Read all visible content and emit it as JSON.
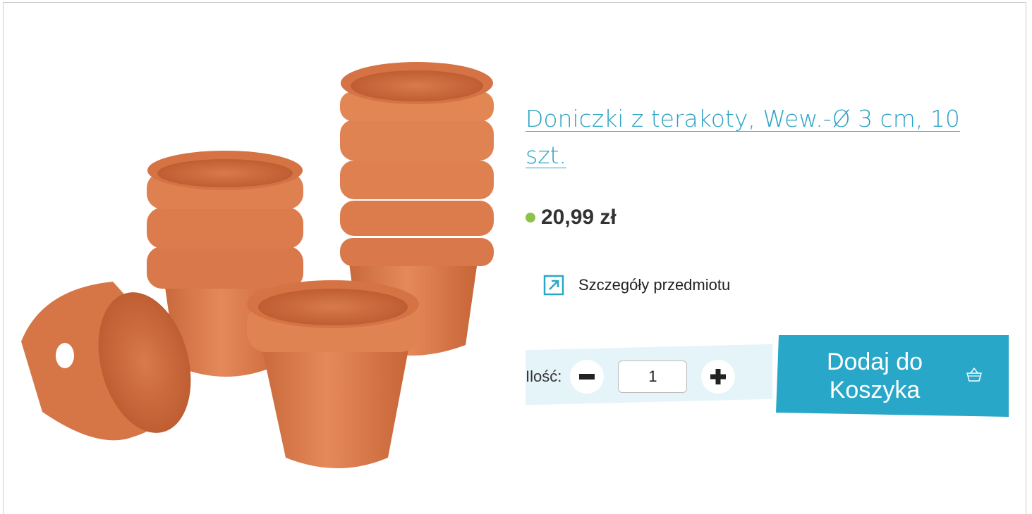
{
  "product": {
    "title": "Doniczki z terakoty, Wew.-Ø 3 cm, 10 szt.",
    "price": "20,99 zł",
    "details_link": "Szczegóły przedmiotu"
  },
  "quantity": {
    "label": "Ilość:",
    "value": "1"
  },
  "cart": {
    "button_label": "Dodaj do Koszyka"
  },
  "colors": {
    "accent": "#29a7c9",
    "stock_dot": "#8bc34a",
    "qty_bg": "#e5f4f9"
  },
  "icons": [
    "external-link-icon",
    "minus-icon",
    "plus-icon",
    "basket-icon"
  ]
}
